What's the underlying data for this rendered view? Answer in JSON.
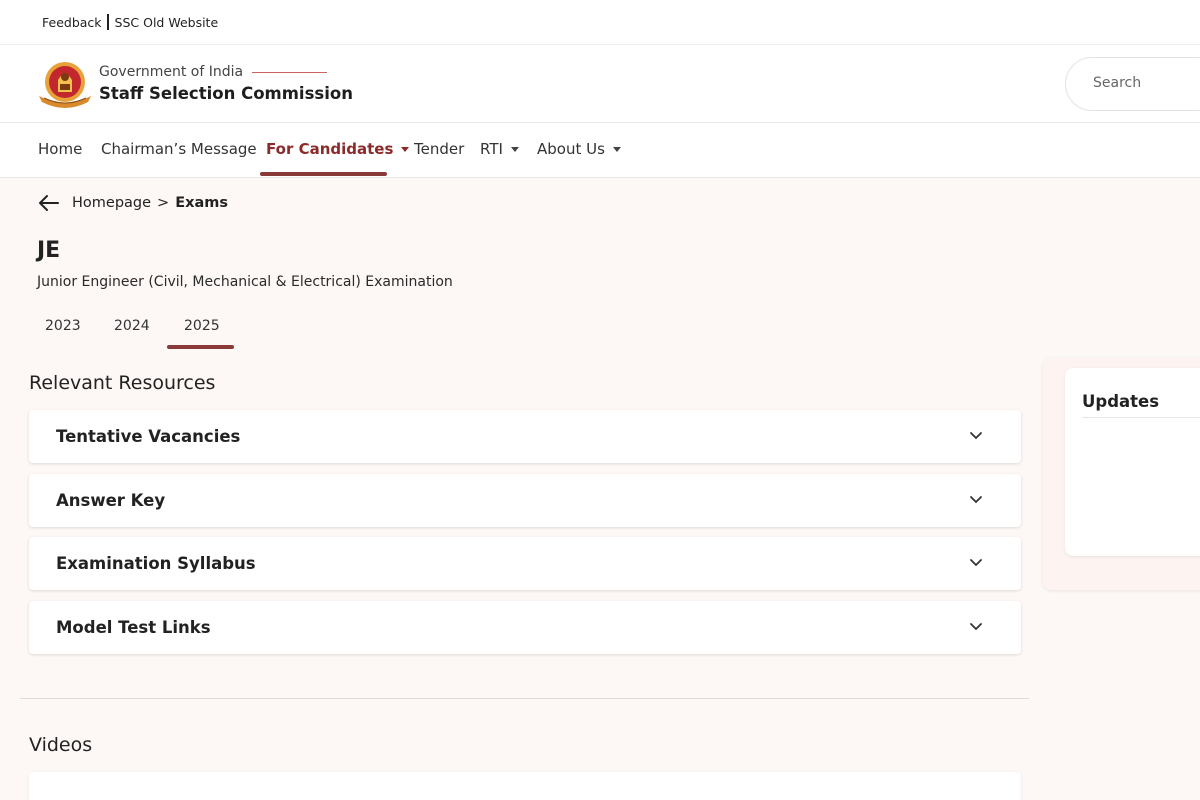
{
  "topbar": {
    "feedback": "Feedback",
    "old_website": "SSC Old Website"
  },
  "header": {
    "gov_label": "Government of India",
    "org_name": "Staff Selection Commission",
    "search_placeholder": "Search"
  },
  "nav": {
    "items": [
      {
        "label": "Home"
      },
      {
        "label": "Chairman’s Message"
      },
      {
        "label": "For Candidates"
      },
      {
        "label": "Tender"
      },
      {
        "label": "RTI"
      },
      {
        "label": "About Us"
      }
    ],
    "active": "For Candidates"
  },
  "breadcrumb": {
    "home": "Homepage",
    "separator": ">",
    "current": "Exams"
  },
  "exam": {
    "title": "JE",
    "subtitle": "Junior Engineer (Civil, Mechanical & Electrical) Examination",
    "years": [
      "2023",
      "2024",
      "2025"
    ],
    "selected_year": "2025"
  },
  "resources": {
    "heading": "Relevant Resources",
    "items": [
      {
        "label": "Tentative Vacancies"
      },
      {
        "label": "Answer Key"
      },
      {
        "label": "Examination Syllabus"
      },
      {
        "label": "Model Test Links"
      }
    ]
  },
  "videos": {
    "heading": "Videos"
  },
  "updates": {
    "heading": "Updates"
  },
  "colors": {
    "accent": "#8b2a2a",
    "background": "#fdf8f6"
  }
}
